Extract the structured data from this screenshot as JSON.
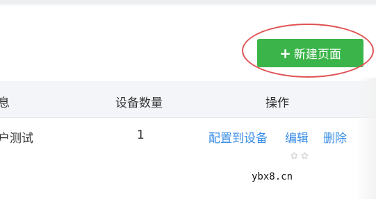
{
  "toolbar": {
    "new_page_label": "新建页面",
    "plus_symbol": "+"
  },
  "table": {
    "headers": {
      "col1_partial": "息",
      "device_count": "设备数量",
      "actions": "操作"
    },
    "rows": [
      {
        "name_partial": "户测试",
        "device_count": "1",
        "actions": {
          "assign": "配置到设备",
          "edit": "编辑",
          "delete": "删除"
        }
      }
    ]
  },
  "watermark": "ybx8.cn",
  "colors": {
    "accent_green": "#3bb54a",
    "link_blue": "#3a8ee6",
    "highlight_red": "#e05252"
  }
}
